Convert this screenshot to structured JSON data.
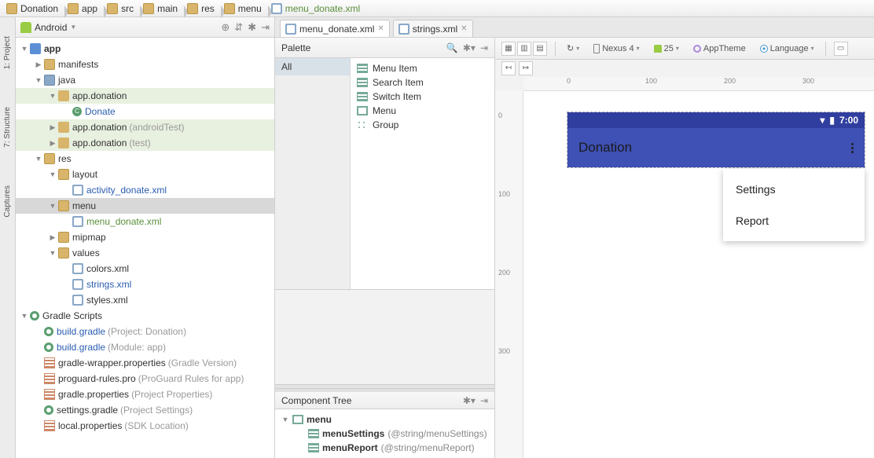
{
  "breadcrumb": [
    {
      "icon": "folder",
      "label": "Donation"
    },
    {
      "icon": "folder",
      "label": "app"
    },
    {
      "icon": "folder",
      "label": "src"
    },
    {
      "icon": "folder",
      "label": "main"
    },
    {
      "icon": "folder",
      "label": "res"
    },
    {
      "icon": "folder",
      "label": "menu"
    },
    {
      "icon": "xml",
      "label": "menu_donate.xml"
    }
  ],
  "leftRail": {
    "project": "1: Project",
    "structure": "7: Structure",
    "captures": "Captures"
  },
  "projectHeader": {
    "view": "Android"
  },
  "tree": {
    "nodes": [
      {
        "d": 0,
        "exp": "▼",
        "ic": "mod",
        "lbl": "app",
        "bold": true,
        "int": true
      },
      {
        "d": 1,
        "exp": "▶",
        "ic": "folder",
        "lbl": "manifests",
        "int": true
      },
      {
        "d": 1,
        "exp": "▼",
        "ic": "folder-o",
        "lbl": "java",
        "int": true
      },
      {
        "d": 2,
        "exp": "▼",
        "ic": "pkg",
        "lbl": "app.donation",
        "int": true,
        "sel": true
      },
      {
        "d": 3,
        "exp": "",
        "ic": "cls",
        "lbl": "Donate",
        "blue": true,
        "int": true
      },
      {
        "d": 2,
        "exp": "▶",
        "ic": "pkg",
        "lbl": "app.donation",
        "q": "(androidTest)",
        "int": true,
        "sel": true
      },
      {
        "d": 2,
        "exp": "▶",
        "ic": "pkg",
        "lbl": "app.donation",
        "q": "(test)",
        "int": true,
        "sel": true
      },
      {
        "d": 1,
        "exp": "▼",
        "ic": "folder",
        "lbl": "res",
        "int": true
      },
      {
        "d": 2,
        "exp": "▼",
        "ic": "folder",
        "lbl": "layout",
        "int": true
      },
      {
        "d": 3,
        "exp": "",
        "ic": "xml",
        "lbl": "activity_donate.xml",
        "blue": true,
        "int": true
      },
      {
        "d": 2,
        "exp": "▼",
        "ic": "folder",
        "lbl": "menu",
        "int": true,
        "hl": true
      },
      {
        "d": 3,
        "exp": "",
        "ic": "xml",
        "lbl": "menu_donate.xml",
        "int": true,
        "green": true
      },
      {
        "d": 2,
        "exp": "▶",
        "ic": "folder",
        "lbl": "mipmap",
        "int": true
      },
      {
        "d": 2,
        "exp": "▼",
        "ic": "folder",
        "lbl": "values",
        "int": true
      },
      {
        "d": 3,
        "exp": "",
        "ic": "xml",
        "lbl": "colors.xml",
        "int": true
      },
      {
        "d": 3,
        "exp": "",
        "ic": "xml",
        "lbl": "strings.xml",
        "blue": true,
        "int": true
      },
      {
        "d": 3,
        "exp": "",
        "ic": "xml",
        "lbl": "styles.xml",
        "int": true
      },
      {
        "d": 0,
        "exp": "▼",
        "ic": "gradle",
        "lbl": "Gradle Scripts",
        "int": true
      },
      {
        "d": 1,
        "exp": "",
        "ic": "gradle",
        "lbl": "build.gradle",
        "q": "(Project: Donation)",
        "blue": true,
        "int": true
      },
      {
        "d": 1,
        "exp": "",
        "ic": "gradle",
        "lbl": "build.gradle",
        "q": "(Module: app)",
        "blue": true,
        "int": true
      },
      {
        "d": 1,
        "exp": "",
        "ic": "prop",
        "lbl": "gradle-wrapper.properties",
        "q": "(Gradle Version)",
        "int": true
      },
      {
        "d": 1,
        "exp": "",
        "ic": "prop",
        "lbl": "proguard-rules.pro",
        "q": "(ProGuard Rules for app)",
        "int": true
      },
      {
        "d": 1,
        "exp": "",
        "ic": "prop",
        "lbl": "gradle.properties",
        "q": "(Project Properties)",
        "int": true
      },
      {
        "d": 1,
        "exp": "",
        "ic": "gradle",
        "lbl": "settings.gradle",
        "q": "(Project Settings)",
        "int": true
      },
      {
        "d": 1,
        "exp": "",
        "ic": "prop",
        "lbl": "local.properties",
        "q": "(SDK Location)",
        "int": true
      }
    ]
  },
  "tabs": [
    {
      "label": "menu_donate.xml",
      "active": true
    },
    {
      "label": "strings.xml",
      "active": false
    }
  ],
  "palette": {
    "title": "Palette",
    "category": "All",
    "items": [
      "Menu Item",
      "Search Item",
      "Switch Item",
      "Menu",
      "Group"
    ]
  },
  "componentTree": {
    "title": "Component Tree",
    "nodes": [
      {
        "d": 0,
        "exp": "▼",
        "ic": "menu",
        "lbl": "menu",
        "bold": true
      },
      {
        "d": 1,
        "exp": "",
        "ic": "item",
        "lbl": "menuSettings",
        "q": "(@string/menuSettings)",
        "bold": true
      },
      {
        "d": 1,
        "exp": "",
        "ic": "item",
        "lbl": "menuReport",
        "q": "(@string/menuReport)",
        "bold": true
      }
    ]
  },
  "canvasToolbar": {
    "device": "Nexus 4",
    "api": "25",
    "theme": "AppTheme",
    "lang": "Language"
  },
  "rulerH": [
    "0",
    "100",
    "200",
    "300"
  ],
  "rulerV": [
    "0",
    "100",
    "200",
    "300"
  ],
  "preview": {
    "time": "7:00",
    "appTitle": "Donation",
    "menu": [
      "Settings",
      "Report"
    ]
  }
}
